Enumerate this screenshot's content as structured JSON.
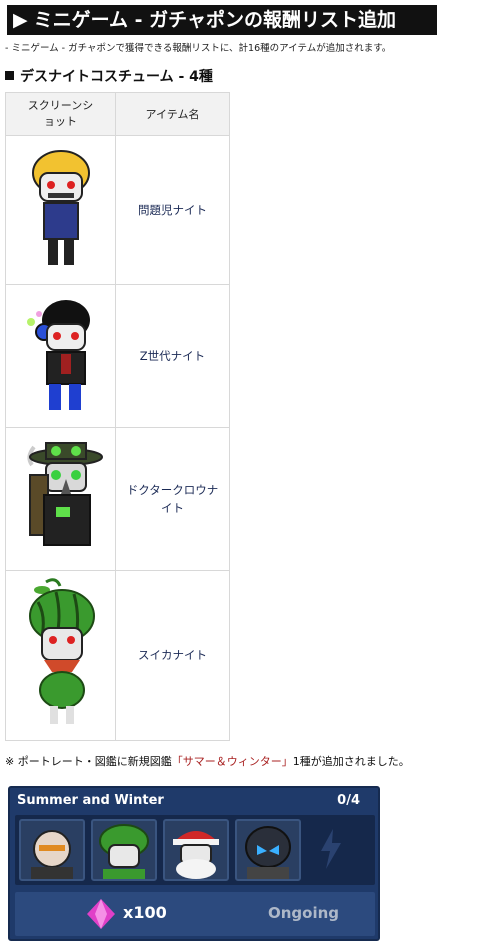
{
  "title": "ミニゲーム - ガチャポンの報酬リスト追加",
  "description": "- ミニゲーム - ガチャポンで獲得できる報酬リストに、計16種のアイテムが追加されます。",
  "section_heading": "デスナイトコスチューム - 4種",
  "table": {
    "headers": [
      "スクリーンショット",
      "アイテム名"
    ],
    "rows": [
      {
        "name": "問題児ナイト"
      },
      {
        "name": "Z世代ナイト"
      },
      {
        "name": "ドクタークロウナイト"
      },
      {
        "name": "スイカナイト"
      }
    ]
  },
  "note": {
    "prefix": "※ ポートレート・図鑑に新規図鑑",
    "quoted": "「サマー＆ウィンター」",
    "suffix": "1種が追加されました。"
  },
  "collection": {
    "title": "Summer and Winter",
    "count": "0/4",
    "reward_amount": "x100",
    "status": "Ongoing"
  },
  "colors": {
    "panel_bg": "#1f3a6a",
    "gem": "#e040c8",
    "quote_text": "#a82020"
  }
}
